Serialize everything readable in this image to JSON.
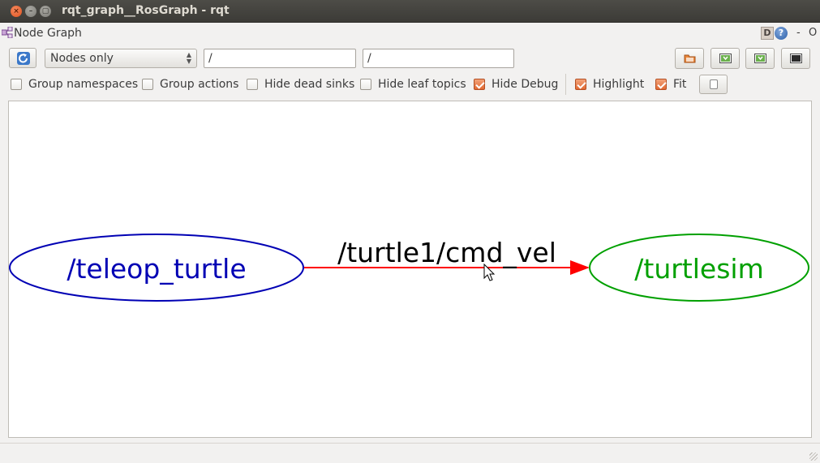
{
  "window": {
    "title": "rqt_graph__RosGraph - rqt",
    "close_glyph": "×",
    "min_glyph": "–",
    "max_glyph": "▢"
  },
  "dock": {
    "title": "Node Graph",
    "d_label": "D",
    "help_label": "?",
    "dash_label": "-",
    "o_label": "O"
  },
  "toolbar": {
    "refresh_icon": "refresh-icon",
    "mode_value": "Nodes only",
    "filter1_value": "/",
    "filter2_value": "/",
    "tool_icons": [
      "open-file-icon",
      "save-dot-icon",
      "save-svg-icon",
      "screenshot-icon"
    ]
  },
  "options": {
    "group_namespaces": {
      "label": "Group namespaces",
      "checked": false
    },
    "group_actions": {
      "label": "Group actions",
      "checked": false
    },
    "hide_dead_sinks": {
      "label": "Hide dead sinks",
      "checked": false
    },
    "hide_leaf_topics": {
      "label": "Hide leaf topics",
      "checked": false
    },
    "hide_debug": {
      "label": "Hide Debug",
      "checked": true
    },
    "highlight": {
      "label": "Highlight",
      "checked": true
    },
    "fit": {
      "label": "Fit",
      "checked": true
    }
  },
  "graph": {
    "nodes": [
      {
        "name": "/teleop_turtle",
        "color": "#0000b4"
      },
      {
        "name": "/turtlesim",
        "color": "#00a000"
      }
    ],
    "edge": {
      "label": "/turtle1/cmd_vel",
      "color": "#ff0000"
    }
  },
  "colors": {
    "accent": "#e26a33",
    "titlebar": "#3c3b37"
  }
}
